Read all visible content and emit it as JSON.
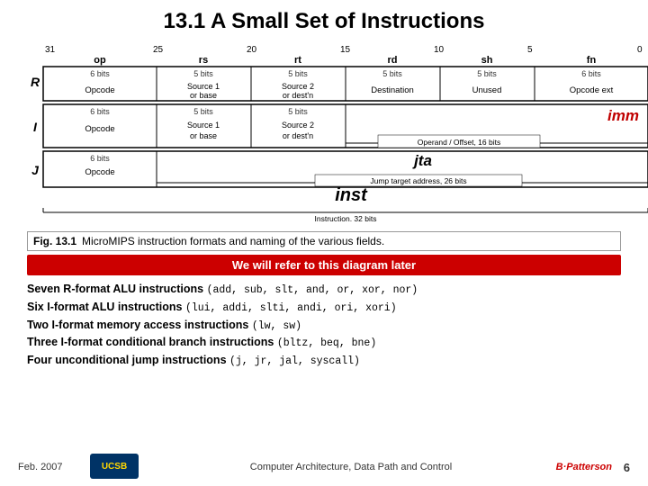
{
  "title": "13.1  A Small Set of Instructions",
  "diagram": {
    "bit_positions": [
      "31",
      "25",
      "20",
      "15",
      "10",
      "5",
      "0"
    ],
    "field_names": [
      "op",
      "rs",
      "rt",
      "rd",
      "sh",
      "fn"
    ],
    "field_bits": [
      "6 bits",
      "5 bits",
      "5 bits",
      "5 bits",
      "5 bits",
      "6 bits"
    ],
    "rows": {
      "R": {
        "label": "R",
        "cells": [
          {
            "bits": "6 bits",
            "label": "Opcode"
          },
          {
            "bits": "5 bits",
            "label": "Source 1\nor base"
          },
          {
            "bits": "5 bits",
            "label": "Source 2\nor dest'n"
          },
          {
            "bits": "5 bits",
            "label": "Destination"
          },
          {
            "bits": "5 bits",
            "label": "Unused"
          },
          {
            "bits": "6 bits",
            "label": "Opcode ext"
          }
        ]
      },
      "I": {
        "label": "I",
        "cells_left": [
          {
            "bits": "6 bits",
            "label": "Opcode"
          },
          {
            "bits": "5 bits",
            "label": "Source 1\nor base"
          },
          {
            "bits": "5 bits",
            "label": "Source 2\nor dest'n"
          }
        ],
        "imm_label": "imm",
        "imm_sublabel": "Operand / Offset, 16 bits"
      },
      "J": {
        "label": "J",
        "cells_left": [
          {
            "bits": "6 bits",
            "label": "Opcode"
          }
        ],
        "jta_label": "jta",
        "jta_sublabel": "Jump target address, 26 bits"
      }
    },
    "inst_label": "inst",
    "inst_sublabel": "Instruction, 32 bits"
  },
  "fig_caption": {
    "fig_num": "Fig. 13.1",
    "text": "MicroMIPS instruction formats and naming of the various fields."
  },
  "highlight": "We will refer to this diagram later",
  "instructions": [
    {
      "prefix": "Seven R-format ALU instructions ",
      "bold": false,
      "detail": "(add, sub, slt, and, or, xor, nor)"
    },
    {
      "prefix": "Six I-format ALU instructions ",
      "bold": false,
      "detail": "(lui, addi, slti, andi, ori, xori)"
    },
    {
      "prefix": "Two I-format memory access instructions ",
      "bold": false,
      "detail": "(lw, sw)"
    },
    {
      "prefix": "Three I-format conditional branch instructions ",
      "bold": false,
      "detail": "(bltz, beq, bne)"
    },
    {
      "prefix": "Four unconditional jump instructions ",
      "bold": false,
      "detail": "(j, jr, jal, syscall)"
    }
  ],
  "footer": {
    "date": "Feb. 2007",
    "logo": "UCSB",
    "center": "Computer Architecture, Data Path and Control",
    "page": "6"
  }
}
